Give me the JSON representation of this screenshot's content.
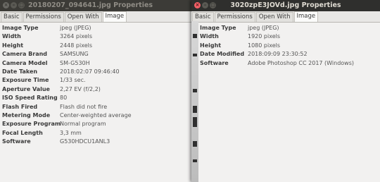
{
  "window1": {
    "title": "20180207_094641.jpg Properties",
    "tabs": [
      "Basic",
      "Permissions",
      "Open With",
      "Image"
    ],
    "active_tab": "Image",
    "properties": [
      {
        "label": "Image Type",
        "value": "jpeg (JPEG)"
      },
      {
        "label": "Width",
        "value": "3264 pixels"
      },
      {
        "label": "Height",
        "value": "2448 pixels"
      },
      {
        "label": "Camera Brand",
        "value": "SAMSUNG"
      },
      {
        "label": "Camera Model",
        "value": "SM-G530H"
      },
      {
        "label": "Date Taken",
        "value": "2018:02:07 09:46:40"
      },
      {
        "label": "Exposure Time",
        "value": "1/33 sec."
      },
      {
        "label": "Aperture Value",
        "value": "2,27 EV (f/2,2)"
      },
      {
        "label": "ISO Speed Rating",
        "value": "80"
      },
      {
        "label": "Flash Fired",
        "value": "Flash did not fire"
      },
      {
        "label": "Metering Mode",
        "value": "Center-weighted average"
      },
      {
        "label": "Exposure Program",
        "value": "Normal program"
      },
      {
        "label": "Focal Length",
        "value": "3,3 mm"
      },
      {
        "label": "Software",
        "value": "G530HDCU1ANL3"
      }
    ]
  },
  "window2": {
    "title": "3020zpE3JOVd.jpg Properties",
    "tabs": [
      "Basic",
      "Permissions",
      "Open With",
      "Image"
    ],
    "active_tab": "Image",
    "properties": [
      {
        "label": "Image Type",
        "value": "jpeg (JPEG)"
      },
      {
        "label": "Width",
        "value": "1920 pixels"
      },
      {
        "label": "Height",
        "value": "1080 pixels"
      },
      {
        "label": "Date Modified",
        "value": "2018:09:09 23:30:52"
      },
      {
        "label": "Software",
        "value": "Adobe Photoshop CC 2017 (Windows)"
      }
    ]
  }
}
